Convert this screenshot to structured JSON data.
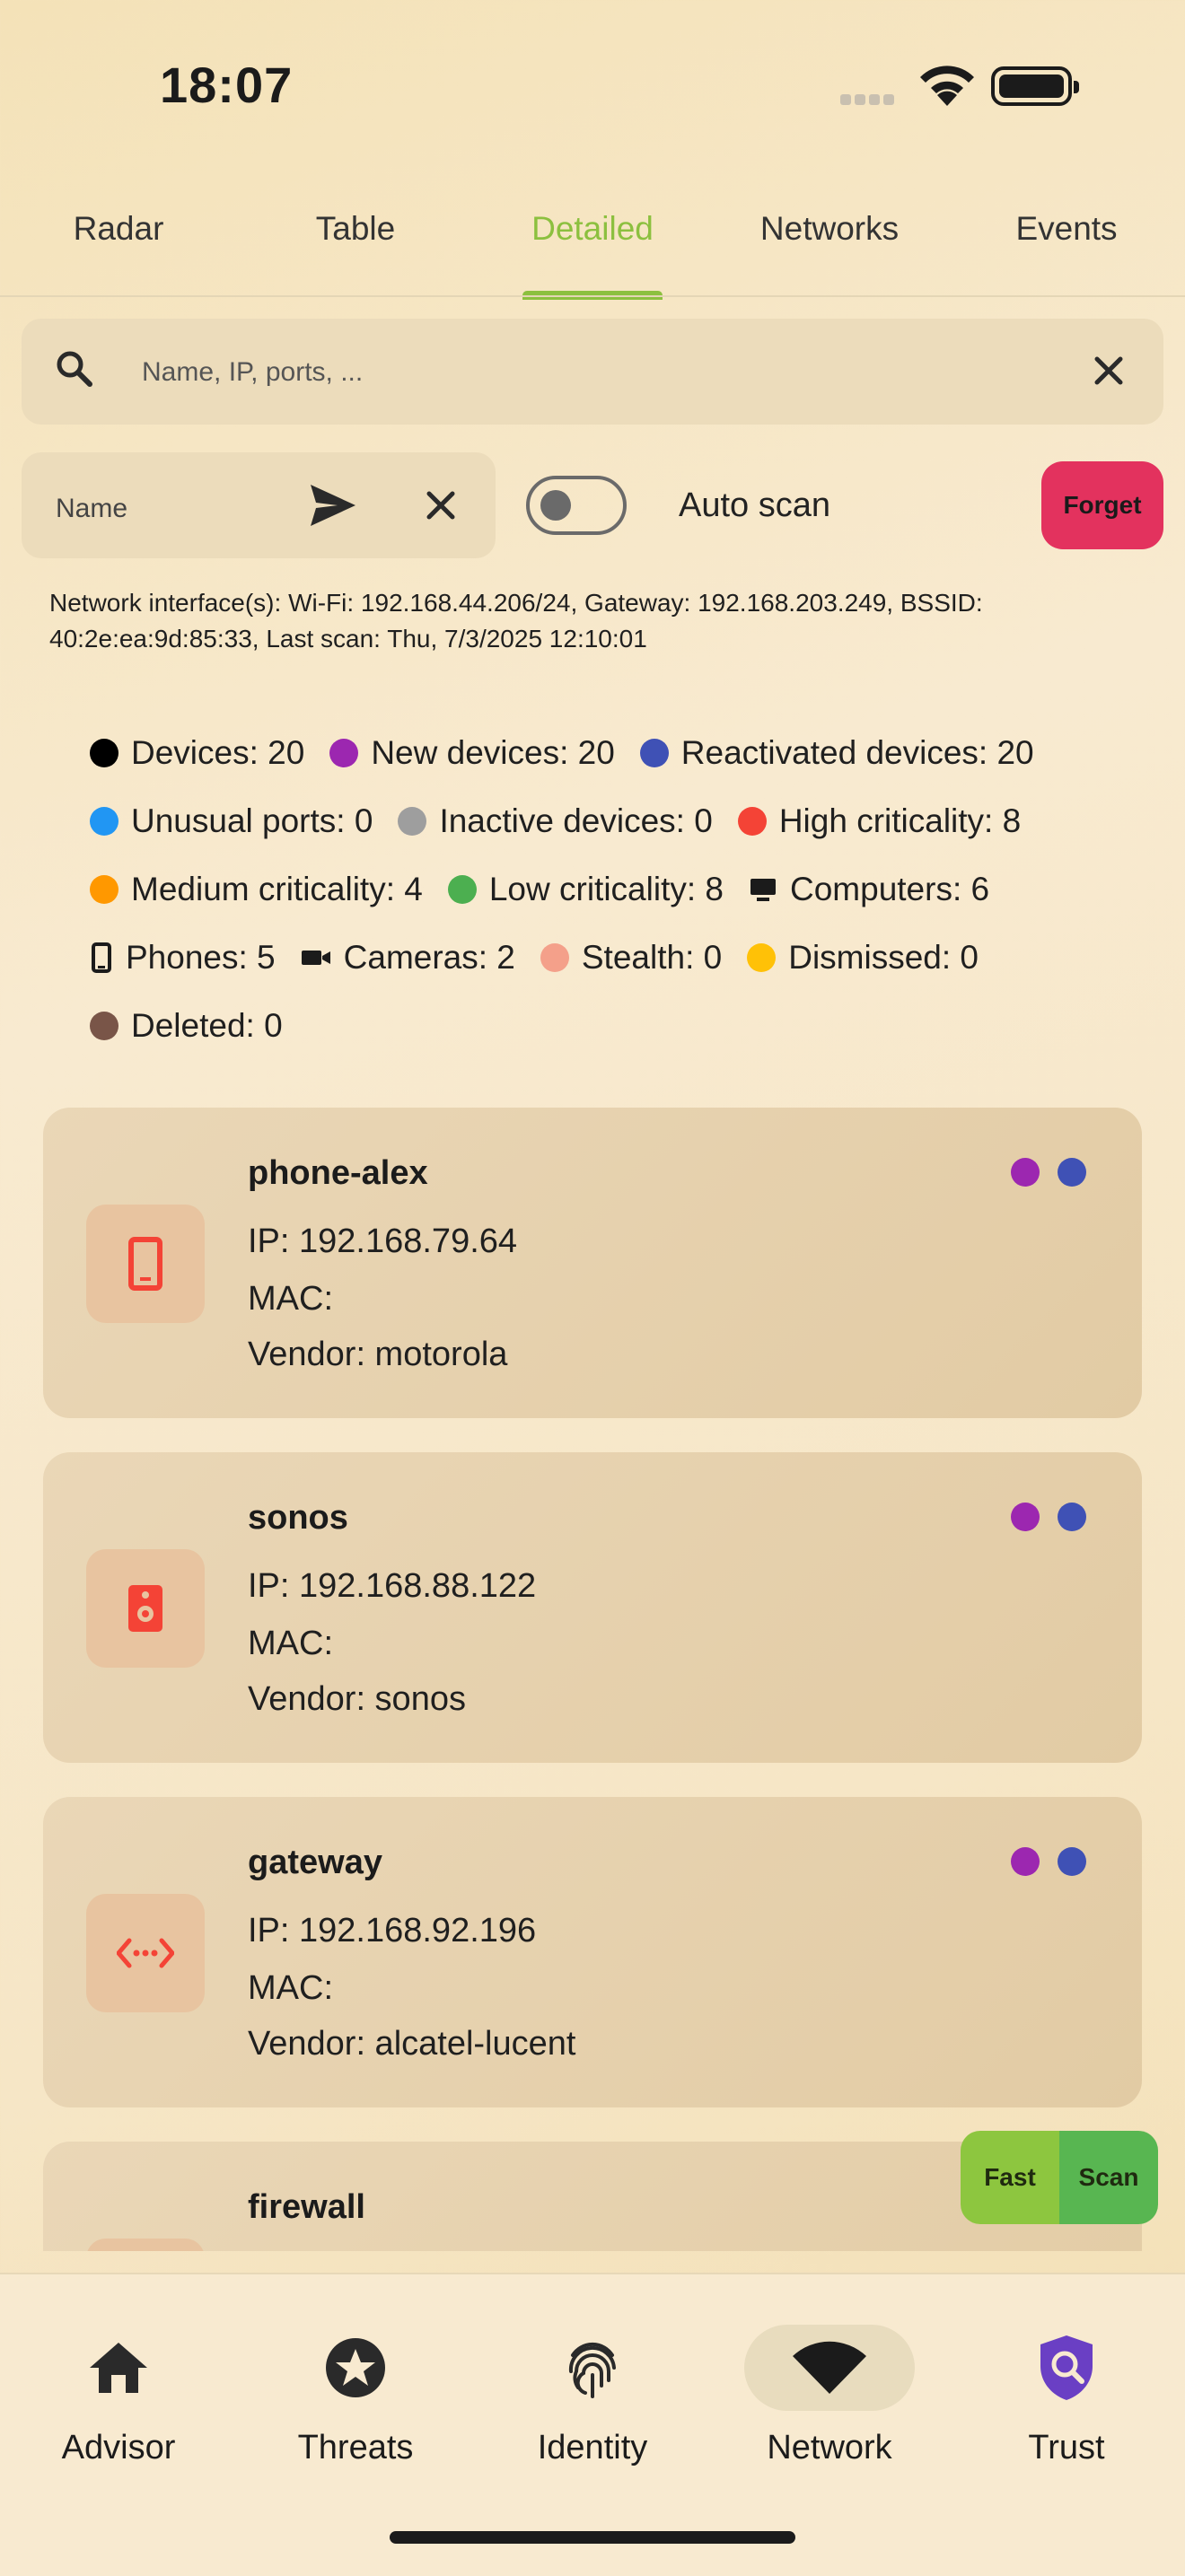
{
  "status": {
    "time": "18:07"
  },
  "tabs": [
    {
      "label": "Radar"
    },
    {
      "label": "Table"
    },
    {
      "label": "Detailed"
    },
    {
      "label": "Networks"
    },
    {
      "label": "Events"
    }
  ],
  "search": {
    "placeholder": "Name, IP, ports, ..."
  },
  "name_field": {
    "placeholder": "Name"
  },
  "auto_scan": {
    "label": "Auto scan",
    "enabled": false
  },
  "forget": {
    "label": "Forget"
  },
  "network_info": "Network interface(s): Wi-Fi: 192.168.44.206/24, Gateway: 192.168.203.249, BSSID: 40:2e:ea:9d:85:33, Last scan: Thu, 7/3/2025 12:10:01",
  "legend": [
    {
      "label": "Devices: 20",
      "color": "#000000",
      "icon": "dot"
    },
    {
      "label": "New devices: 20",
      "color": "#9c27b0",
      "icon": "dot"
    },
    {
      "label": "Reactivated devices: 20",
      "color": "#3f51b5",
      "icon": "dot"
    },
    {
      "label": "Unusual ports: 0",
      "color": "#2196f3",
      "icon": "dot"
    },
    {
      "label": "Inactive devices: 0",
      "color": "#9e9e9e",
      "icon": "dot"
    },
    {
      "label": "High criticality: 8",
      "color": "#f44336",
      "icon": "dot"
    },
    {
      "label": "Medium criticality: 4",
      "color": "#ff9800",
      "icon": "dot"
    },
    {
      "label": "Low criticality: 8",
      "color": "#4caf50",
      "icon": "dot"
    },
    {
      "label": "Computers: 6",
      "color": "#1b1b1b",
      "icon": "computer-icon"
    },
    {
      "label": "Phones: 5",
      "color": "#1b1b1b",
      "icon": "phone-icon"
    },
    {
      "label": "Cameras: 2",
      "color": "#1b1b1b",
      "icon": "camera-icon"
    },
    {
      "label": "Stealth: 0",
      "color": "#f4a08a",
      "icon": "dot"
    },
    {
      "label": "Dismissed: 0",
      "color": "#ffc107",
      "icon": "dot"
    },
    {
      "label": "Deleted: 0",
      "color": "#795548",
      "icon": "dot"
    }
  ],
  "devices": [
    {
      "name": "phone-alex",
      "ip": "IP: 192.168.79.64",
      "mac": "MAC:",
      "vendor": "Vendor: motorola",
      "icon": "phone-icon",
      "icon_color": "#f44336",
      "tags": [
        "#9c27b0",
        "#3f51b5"
      ]
    },
    {
      "name": "sonos",
      "ip": "IP: 192.168.88.122",
      "mac": "MAC:",
      "vendor": "Vendor: sonos",
      "icon": "speaker-icon",
      "icon_color": "#f44336",
      "tags": [
        "#9c27b0",
        "#3f51b5"
      ]
    },
    {
      "name": "gateway",
      "ip": "IP: 192.168.92.196",
      "mac": "MAC:",
      "vendor": "Vendor: alcatel-lucent",
      "icon": "router-icon",
      "icon_color": "#f44336",
      "tags": [
        "#9c27b0",
        "#3f51b5"
      ]
    },
    {
      "name": "firewall",
      "ip": "",
      "mac": "",
      "vendor": "",
      "icon": "firewall-icon",
      "icon_color": "#f44336",
      "tags": []
    }
  ],
  "scan_buttons": {
    "fast": "Fast",
    "scan": "Scan"
  },
  "bottom_nav": [
    {
      "label": "Advisor",
      "icon": "home-icon"
    },
    {
      "label": "Threats",
      "icon": "star-badge-icon"
    },
    {
      "label": "Identity",
      "icon": "fingerprint-icon"
    },
    {
      "label": "Network",
      "icon": "wifi-icon",
      "active": true
    },
    {
      "label": "Trust",
      "icon": "shield-search-icon"
    }
  ]
}
